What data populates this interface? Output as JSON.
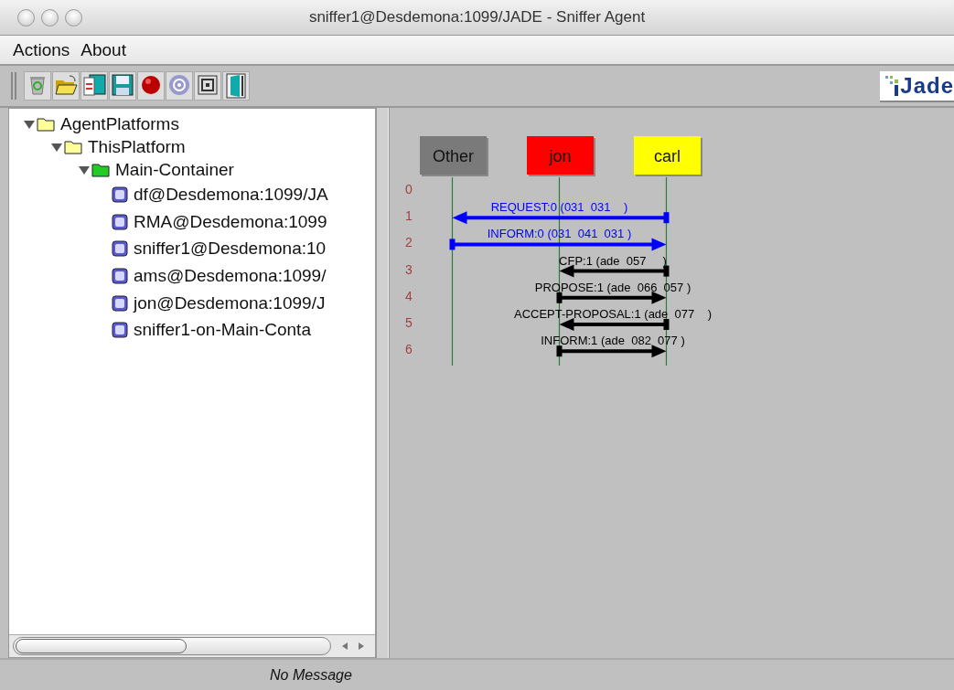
{
  "window": {
    "title": "sniffer1@Desdemona:1099/JADE - Sniffer Agent"
  },
  "menu": [
    "Actions",
    "About"
  ],
  "toolbar": {
    "logo": "Jade"
  },
  "tree": [
    {
      "label": "AgentPlatforms",
      "kind": "folder",
      "expanded": true,
      "children": [
        {
          "label": "ThisPlatform",
          "kind": "folder",
          "expanded": true,
          "children": [
            {
              "label": "Main-Container",
              "kind": "container",
              "expanded": true,
              "children": [
                {
                  "label": "df@Desdemona:1099/JA",
                  "kind": "agent"
                },
                {
                  "label": "RMA@Desdemona:1099",
                  "kind": "agent"
                },
                {
                  "label": "sniffer1@Desdemona:10",
                  "kind": "agent"
                },
                {
                  "label": "ams@Desdemona:1099/",
                  "kind": "agent"
                },
                {
                  "label": "jon@Desdemona:1099/J",
                  "kind": "agent"
                },
                {
                  "label": "sniffer1-on-Main-Conta",
                  "kind": "agent"
                }
              ]
            }
          ]
        }
      ]
    }
  ],
  "diagram": {
    "agents": [
      {
        "name": "Other",
        "color": "#7a7a7a"
      },
      {
        "name": "jon",
        "color": "#ff0000"
      },
      {
        "name": "carl",
        "color": "#ffff00"
      }
    ],
    "rows": [
      "0",
      "1",
      "2",
      "3",
      "4",
      "5",
      "6"
    ],
    "messages": [
      {
        "label": "REQUEST:0 (031  031    )",
        "kind": "wide",
        "leftward": true,
        "color": "#0000ff"
      },
      {
        "label": "INFORM:0 (031  041  031 )",
        "kind": "wide",
        "leftward": false,
        "color": "#0000ff"
      },
      {
        "label": "CFP:1 (ade  057     )",
        "kind": "narrow",
        "leftward": true,
        "color": "#000000"
      },
      {
        "label": "PROPOSE:1 (ade  066  057 )",
        "kind": "narrow",
        "leftward": false,
        "color": "#000000"
      },
      {
        "label": "ACCEPT-PROPOSAL:1 (ade  077    )",
        "kind": "narrow",
        "leftward": true,
        "color": "#000000"
      },
      {
        "label": "INFORM:1 (ade  082  077 )",
        "kind": "narrow",
        "leftward": false,
        "color": "#000000"
      }
    ]
  },
  "status_bar": "No Message"
}
